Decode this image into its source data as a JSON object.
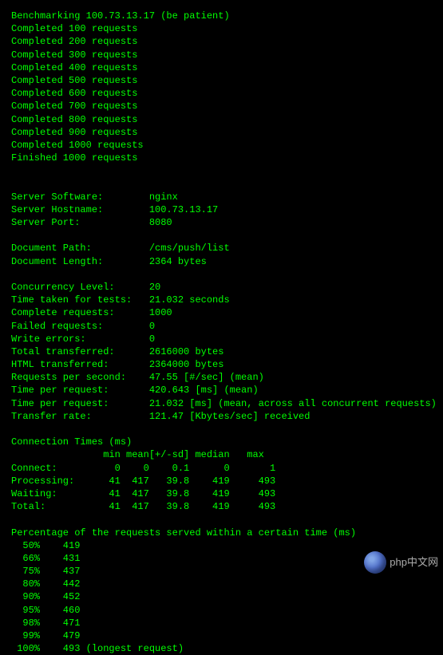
{
  "progress": {
    "header_prefix": "Benchmarking ",
    "header_host": "100.73.13.17",
    "header_suffix": " (be patient)",
    "completed_prefix": "Completed ",
    "completed_suffix": " requests",
    "completed": [
      100,
      200,
      300,
      400,
      500,
      600,
      700,
      800,
      900,
      1000
    ],
    "finished": "Finished 1000 requests"
  },
  "stats": {
    "server_software": {
      "label": "Server Software:",
      "value": "nginx"
    },
    "server_hostname": {
      "label": "Server Hostname:",
      "value": "100.73.13.17"
    },
    "server_port": {
      "label": "Server Port:",
      "value": "8080"
    },
    "document_path": {
      "label": "Document Path:",
      "value": "/cms/push/list"
    },
    "document_length": {
      "label": "Document Length:",
      "value": "2364 bytes"
    },
    "concurrency_level": {
      "label": "Concurrency Level:",
      "value": "20"
    },
    "time_taken": {
      "label": "Time taken for tests:",
      "value": "21.032 seconds"
    },
    "complete_requests": {
      "label": "Complete requests:",
      "value": "1000"
    },
    "failed_requests": {
      "label": "Failed requests:",
      "value": "0"
    },
    "write_errors": {
      "label": "Write errors:",
      "value": "0"
    },
    "total_transferred": {
      "label": "Total transferred:",
      "value": "2616000 bytes"
    },
    "html_transferred": {
      "label": "HTML transferred:",
      "value": "2364000 bytes"
    },
    "requests_per_second": {
      "label": "Requests per second:",
      "value": "47.55 [#/sec] (mean)"
    },
    "time_per_request1": {
      "label": "Time per request:",
      "value": "420.643 [ms] (mean)"
    },
    "time_per_request2": {
      "label": "Time per request:",
      "value": "21.032 [ms] (mean, across all concurrent requests)"
    },
    "transfer_rate": {
      "label": "Transfer rate:",
      "value": "121.47 [Kbytes/sec] received"
    }
  },
  "connection_times": {
    "title": "Connection Times (ms)",
    "header": {
      "min": "min",
      "mean": "mean",
      "sd": "[+/-sd]",
      "median": "median",
      "max": "max"
    },
    "rows": [
      {
        "name": "Connect:",
        "min": "0",
        "mean": "0",
        "sd": "0.1",
        "median": "0",
        "max": "1"
      },
      {
        "name": "Processing:",
        "min": "41",
        "mean": "417",
        "sd": "39.8",
        "median": "419",
        "max": "493"
      },
      {
        "name": "Waiting:",
        "min": "41",
        "mean": "417",
        "sd": "39.8",
        "median": "419",
        "max": "493"
      },
      {
        "name": "Total:",
        "min": "41",
        "mean": "417",
        "sd": "39.8",
        "median": "419",
        "max": "493"
      }
    ]
  },
  "percentiles": {
    "title": "Percentage of the requests served within a certain time (ms)",
    "rows": [
      {
        "pct": "50%",
        "val": "419",
        "note": ""
      },
      {
        "pct": "66%",
        "val": "431",
        "note": ""
      },
      {
        "pct": "75%",
        "val": "437",
        "note": ""
      },
      {
        "pct": "80%",
        "val": "442",
        "note": ""
      },
      {
        "pct": "90%",
        "val": "452",
        "note": ""
      },
      {
        "pct": "95%",
        "val": "460",
        "note": ""
      },
      {
        "pct": "98%",
        "val": "471",
        "note": ""
      },
      {
        "pct": "99%",
        "val": "479",
        "note": ""
      },
      {
        "pct": "100%",
        "val": "493",
        "note": " (longest request)"
      }
    ]
  },
  "watermark": {
    "text": "php中文网"
  }
}
